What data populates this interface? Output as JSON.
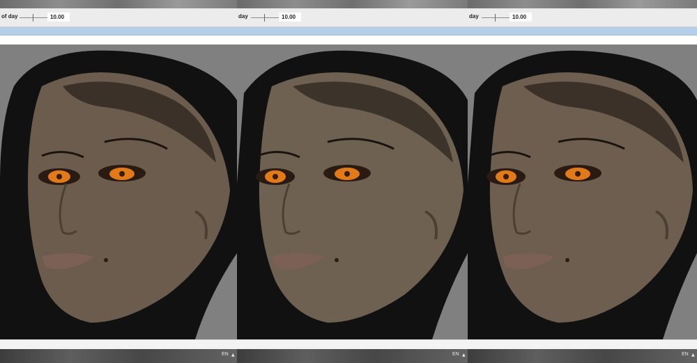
{
  "panels": [
    {
      "tod_label": "of day",
      "slider_value": "10.00",
      "language": "EN",
      "tray_arrow": "▲"
    },
    {
      "tod_label": "day",
      "slider_value": "10.00",
      "language": "EN",
      "tray_arrow": "▲"
    },
    {
      "tod_label": "day",
      "slider_value": "10.00",
      "language": "EN",
      "tray_arrow": "▲"
    }
  ],
  "colors": {
    "toolbar_bg": "#ececec",
    "selection_bar": "#b6cfe8",
    "viewport_bg": "#828282",
    "skin": "#6e5f50",
    "hair": "#111111",
    "iris": "#e07a1a"
  },
  "icons": [
    "slider-icon",
    "tray-up-arrow-icon"
  ]
}
